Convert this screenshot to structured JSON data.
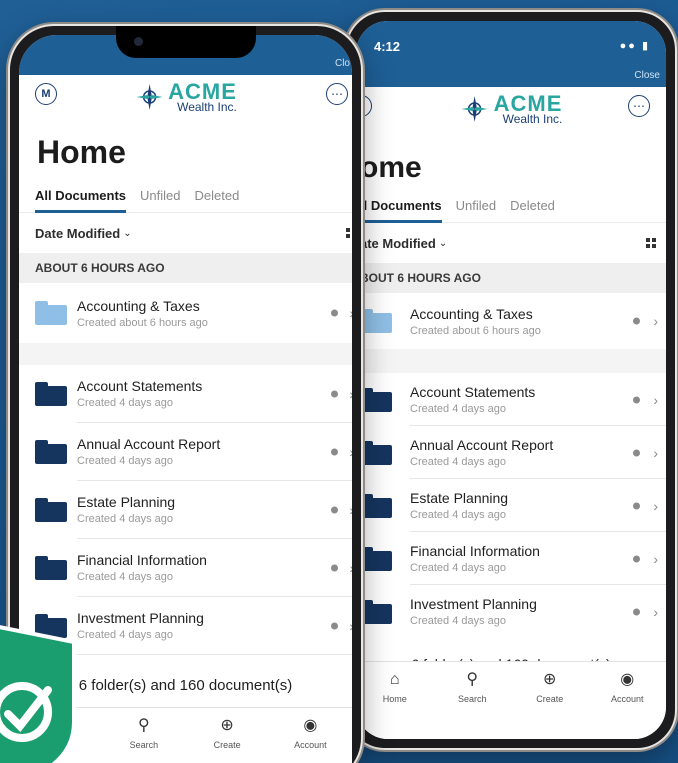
{
  "app": {
    "status_time": "4:12",
    "close_label": "Close",
    "close_label_clipped": "Clo",
    "brand_name": "ACME",
    "brand_sub": "Wealth Inc.",
    "avatar_initial": "M",
    "more_icon": "ellipsis-circle-icon",
    "page_title": "Home",
    "page_title_clipped": "ome"
  },
  "tabs": [
    {
      "label": "All Documents",
      "active": true
    },
    {
      "label": "Unfiled",
      "active": false
    },
    {
      "label": "Deleted",
      "active": false
    }
  ],
  "tabs_clipped_first": "ll Documents",
  "sort": {
    "label": "Date Modified",
    "label_clipped": "ate Modified"
  },
  "section": {
    "header": "ABOUT 6 HOURS AGO",
    "header_clipped": "BOUT 6 HOURS AGO"
  },
  "items": [
    {
      "name": "Accounting & Taxes",
      "sub": "Created about 6 hours ago",
      "color": "#8fbfe6"
    },
    {
      "name": "Account Statements",
      "sub": "Created 4 days ago",
      "color": "#15355f"
    },
    {
      "name": "Annual Account Report",
      "sub": "Created 4 days ago",
      "color": "#15355f"
    },
    {
      "name": "Estate Planning",
      "sub": "Created 4 days ago",
      "color": "#15355f"
    },
    {
      "name": "Financial Information",
      "sub": "Created 4 days ago",
      "color": "#15355f"
    },
    {
      "name": "Investment Planning",
      "sub": "Created 4 days ago",
      "color": "#15355f"
    }
  ],
  "summary": "6 folder(s) and 160 document(s)",
  "tabbar": [
    {
      "label": "Home",
      "icon": "home-icon"
    },
    {
      "label": "Search",
      "icon": "search-icon"
    },
    {
      "label": "Create",
      "icon": "plus-circle-icon"
    },
    {
      "label": "Account",
      "icon": "account-circle-icon"
    }
  ],
  "tabbar_home_clipped": "me",
  "colors": {
    "brand_blue": "#1e5f96",
    "brand_teal": "#2aa6a0",
    "navy": "#15355f",
    "badge_green": "#1a9e6f"
  }
}
